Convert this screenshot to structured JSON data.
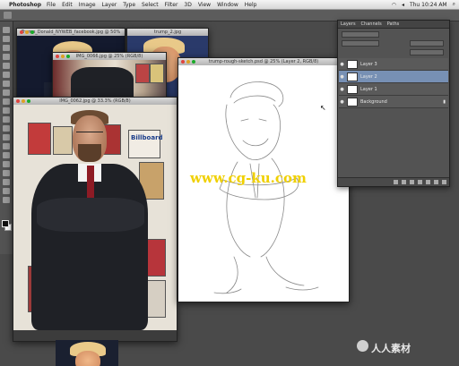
{
  "menubar": {
    "apple": "",
    "app": "Photoshop",
    "items": [
      "File",
      "Edit",
      "Image",
      "Layer",
      "Type",
      "Select",
      "Filter",
      "3D",
      "View",
      "Window",
      "Help"
    ],
    "clock": "Thu 10:24 AM"
  },
  "windows": {
    "photo_main_title": "IMG_0062.jpg @ 33.3% (RGB/8)",
    "photo_small_title": "IMG_0066.jpg @ 25% (RGB/8)",
    "photo_back_title": "Trump_Donald_NYWEB_facebook.jpg @ 50%",
    "photo_back2_title": "trump_2.jpg",
    "sketch_title": "trump-rough-sketch.psd @ 25% (Layer 2, RGB/8)"
  },
  "layers_panel": {
    "tabs": [
      "Layers",
      "Channels",
      "Paths"
    ],
    "layers": [
      {
        "name": "Layer 3",
        "selected": false
      },
      {
        "name": "Layer 2",
        "selected": true
      },
      {
        "name": "Layer 1",
        "selected": false
      },
      {
        "name": "Background",
        "selected": false
      }
    ]
  },
  "watermark": {
    "url": "www.cg-ku.com",
    "brand": "人人素材"
  },
  "photo_text": {
    "billboard": "Billboard"
  }
}
